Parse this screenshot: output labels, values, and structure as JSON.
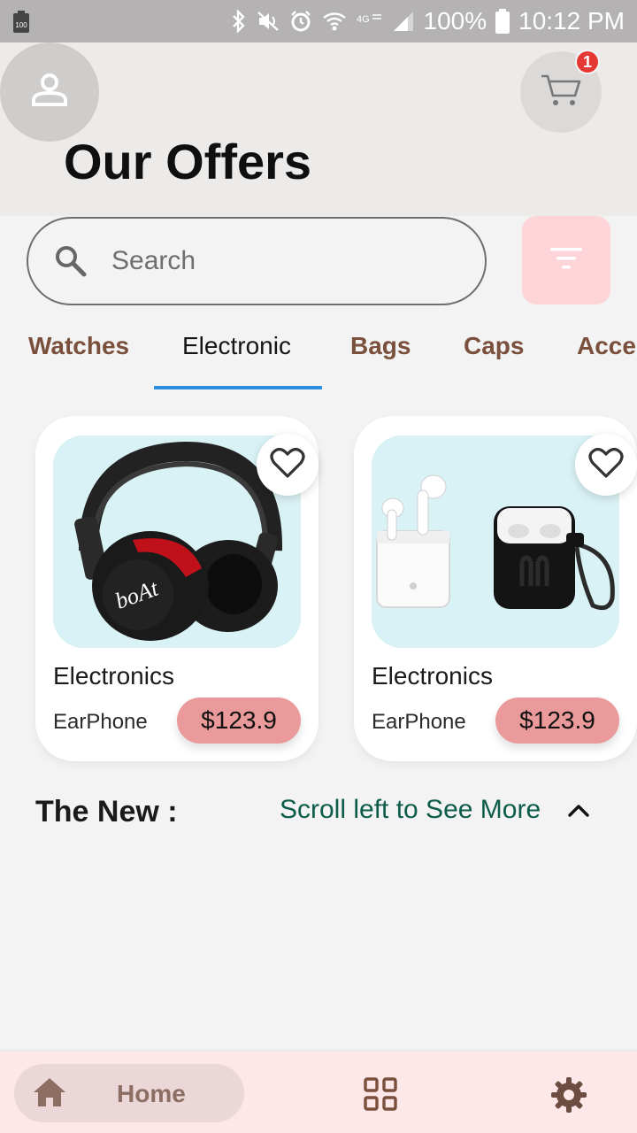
{
  "status_bar": {
    "battery_left": "100",
    "battery_percent": "100%",
    "time": "10:12 PM"
  },
  "header": {
    "title": "Our Offers",
    "cart_count": "1"
  },
  "search": {
    "placeholder": "Search"
  },
  "tabs": [
    {
      "label": "Watches"
    },
    {
      "label": "Electronic"
    },
    {
      "label": "Bags"
    },
    {
      "label": "Caps"
    },
    {
      "label": "Accessories"
    }
  ],
  "products": [
    {
      "category": "Electronics",
      "name": "EarPhone",
      "price": "$123.9",
      "brand_text": "boAt",
      "image": "headphones"
    },
    {
      "category": "Electronics",
      "name": "EarPhone",
      "price": "$123.9",
      "image": "earbuds-with-case"
    }
  ],
  "section": {
    "title": "The New :",
    "scroll_hint": "Scroll left to See More"
  },
  "bottom_nav": {
    "home_label": "Home"
  },
  "colors": {
    "header_bg": "#ecebe9",
    "accent_tab": "#2e8fde",
    "price_pill": "#ea9a9a",
    "filter_bg": "#fdd5d8",
    "nav_bg": "#fde7e9",
    "tab_text": "#7a4f3c"
  }
}
